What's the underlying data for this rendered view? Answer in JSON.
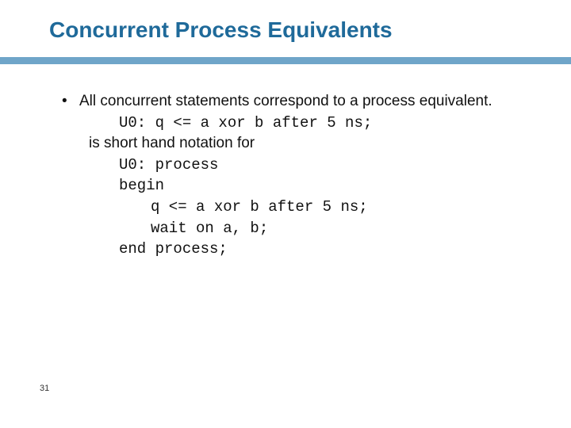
{
  "title": "Concurrent Process Equivalents",
  "bullet_marker": "•",
  "bullet_text": "All concurrent statements correspond to a process equivalent.",
  "code_line_1": "U0: q <= a xor b after 5 ns;",
  "short_hand_text": "is short hand notation for",
  "code_line_2": "U0: process",
  "code_line_3": "begin",
  "code_line_4": "q <= a xor b after 5 ns;",
  "code_line_5": "wait on a, b;",
  "code_line_6": "end process;",
  "page_number": "31"
}
